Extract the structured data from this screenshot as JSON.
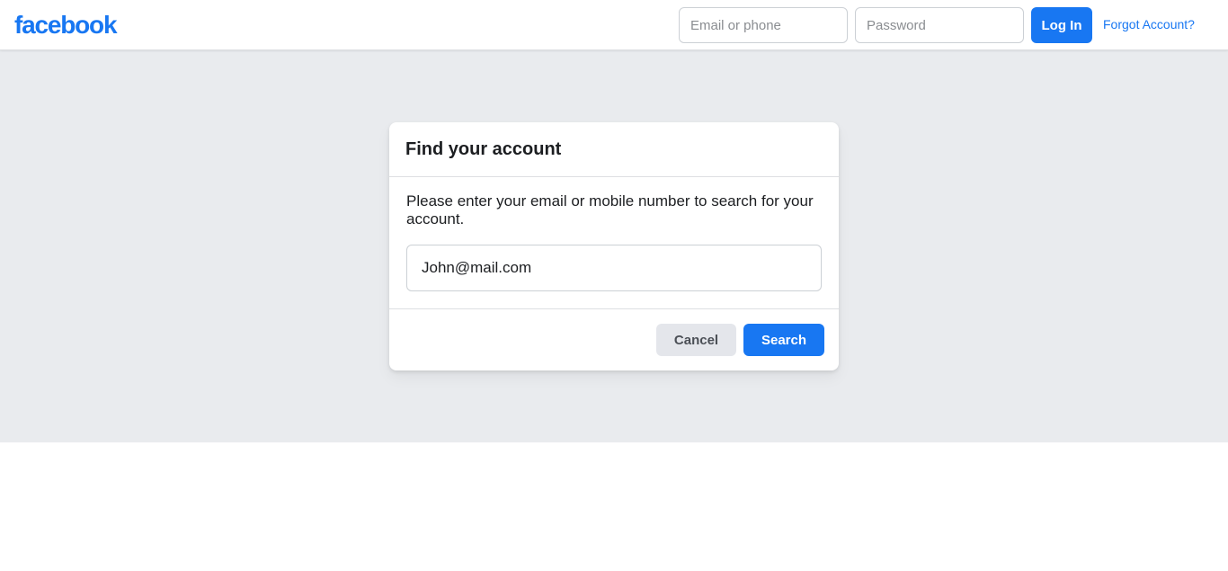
{
  "header": {
    "logo_text": "facebook",
    "email_placeholder": "Email or phone",
    "password_placeholder": "Password",
    "login_label": "Log In",
    "forgot_label": "Forgot Account?"
  },
  "dialog": {
    "title": "Find your account",
    "description": "Please enter your email or mobile number to search for your account.",
    "input_value": "John@mail.com",
    "cancel_label": "Cancel",
    "search_label": "Search"
  },
  "colors": {
    "brand_blue": "#1877f2",
    "page_background": "#e9ebee",
    "cancel_button": "#e4e6eb"
  }
}
